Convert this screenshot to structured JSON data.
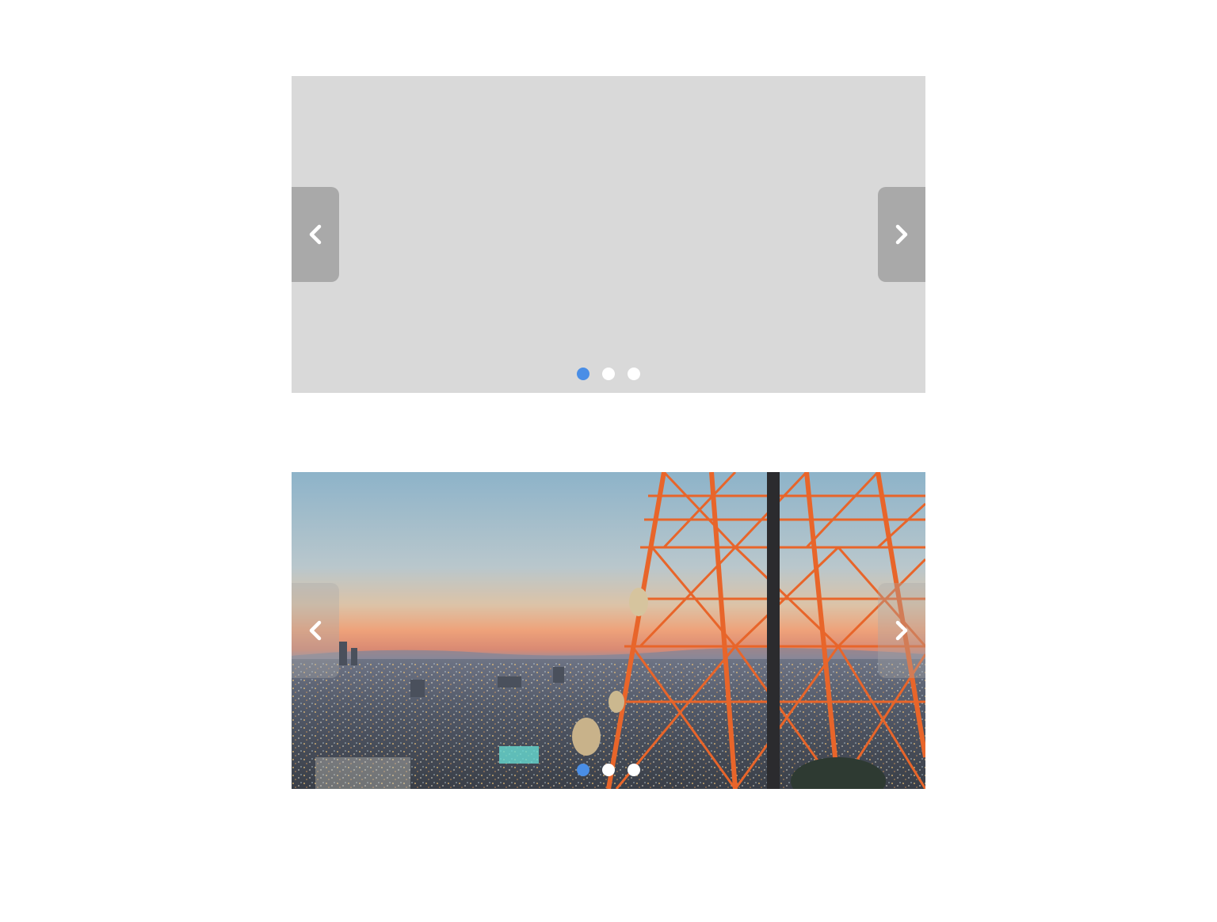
{
  "carousels": [
    {
      "id": "top",
      "slide_state": "loading-placeholder",
      "active_index": 0,
      "dot_count": 3,
      "colors": {
        "placeholder": "#d9d9d9",
        "active_dot": "#4a8ee6",
        "dot": "#ffffff"
      },
      "icons": {
        "prev": "chevron-left-icon",
        "next": "chevron-right-icon"
      }
    },
    {
      "id": "bottom",
      "slide_state": "image",
      "slide_subject": "city-skyline-with-orange-lattice-tower",
      "active_index": 0,
      "dot_count": 3,
      "colors": {
        "tower": "#e8652a",
        "active_dot": "#4a8ee6",
        "dot": "#ffffff"
      },
      "icons": {
        "prev": "chevron-left-icon",
        "next": "chevron-right-icon"
      }
    }
  ]
}
